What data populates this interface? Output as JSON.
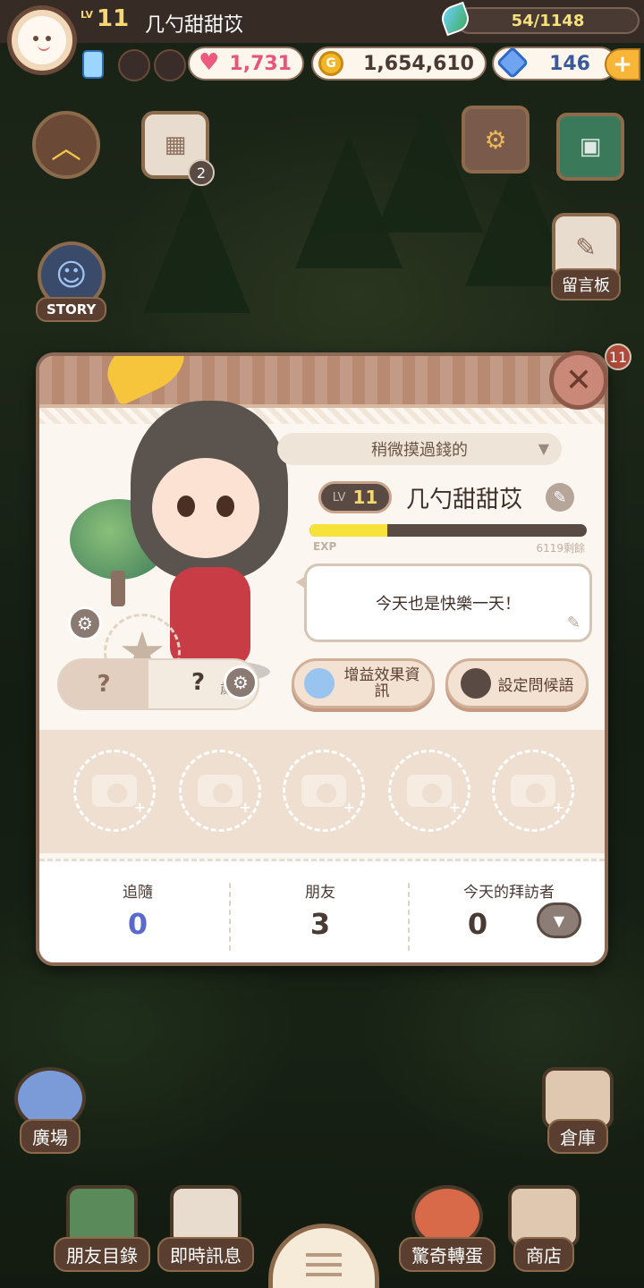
{
  "player": {
    "level_tag": "LV",
    "level": "11",
    "name": "几勺甜甜苡"
  },
  "resources": {
    "energy": "54/1148",
    "hearts": "1,731",
    "gold": "1,654,610",
    "gems": "146",
    "plus": "+"
  },
  "side_buttons": {
    "story": "STORY",
    "calendar_badge": "2",
    "board": "留言板",
    "notice_badge": "11"
  },
  "popup": {
    "title_select": "稍微摸過錢的",
    "level_tag": "LV",
    "level": "11",
    "name": "几勺甜甜苡",
    "exp_label": "EXP",
    "exp_remaining": "6119剩餘",
    "exp_fraction": 0.28,
    "greeting": "今天也是快樂一天！",
    "age_question": "?",
    "age_unit": "歲",
    "buff_button": "增益效果資訊",
    "greeting_button": "設定問候語",
    "close": "✕",
    "stats": [
      {
        "label": "追隨",
        "value": "0",
        "color": "#5a6acc"
      },
      {
        "label": "朋友",
        "value": "3",
        "color": "#4a3a34"
      },
      {
        "label": "今天的拜訪者",
        "value": "0",
        "color": "#4a3a34"
      }
    ]
  },
  "bottom": {
    "plaza": "廣場",
    "storage": "倉庫",
    "friends": "朋友目錄",
    "messages": "即時訊息",
    "gacha": "驚奇轉蛋",
    "shop": "商店"
  },
  "icons": {
    "leaf": "leaf-icon",
    "heart": "heart-icon",
    "coin": "coin-icon",
    "gem": "gem-icon",
    "camera": "camera-icon",
    "gear": "gear-icon",
    "edit": "edit-icon"
  },
  "colors": {
    "accent": "#c98878",
    "panel": "#fbf6ef",
    "exp_fill": "#f7e23a",
    "follow_value": "#5a6acc"
  }
}
